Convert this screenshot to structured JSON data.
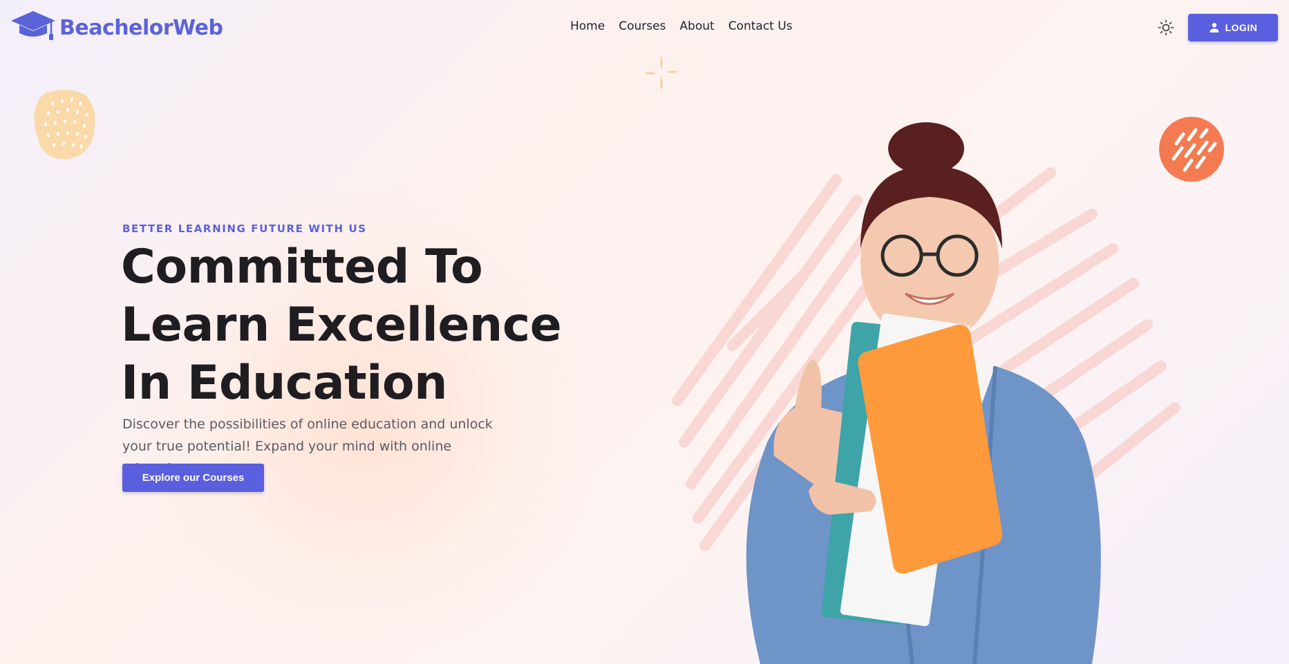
{
  "brand": {
    "name": "BeachelorWeb",
    "icon": "graduation-cap-icon",
    "color": "#5b63d8"
  },
  "nav": {
    "items": [
      {
        "label": "Home"
      },
      {
        "label": "Courses"
      },
      {
        "label": "About"
      },
      {
        "label": "Contact Us"
      }
    ],
    "theme_icon": "sun-icon",
    "login_label": "LOGIN",
    "login_icon": "user-icon"
  },
  "hero": {
    "tagline": "BETTER LEARNING FUTURE WITH US",
    "title_lines": [
      "Committed To",
      "Learn Excellence",
      "In Education"
    ],
    "description": "Discover the possibilities of online education and unlock your true potential! Expand your mind with online education.",
    "cta_label": "Explore our Courses"
  },
  "colors": {
    "accent": "#5a5fde",
    "heading": "#1f1d22",
    "body_text": "#5a5a66",
    "blob_orange": "#f47a52",
    "blob_peach": "#fbd9a8",
    "sparkle": "#f9c98a"
  }
}
